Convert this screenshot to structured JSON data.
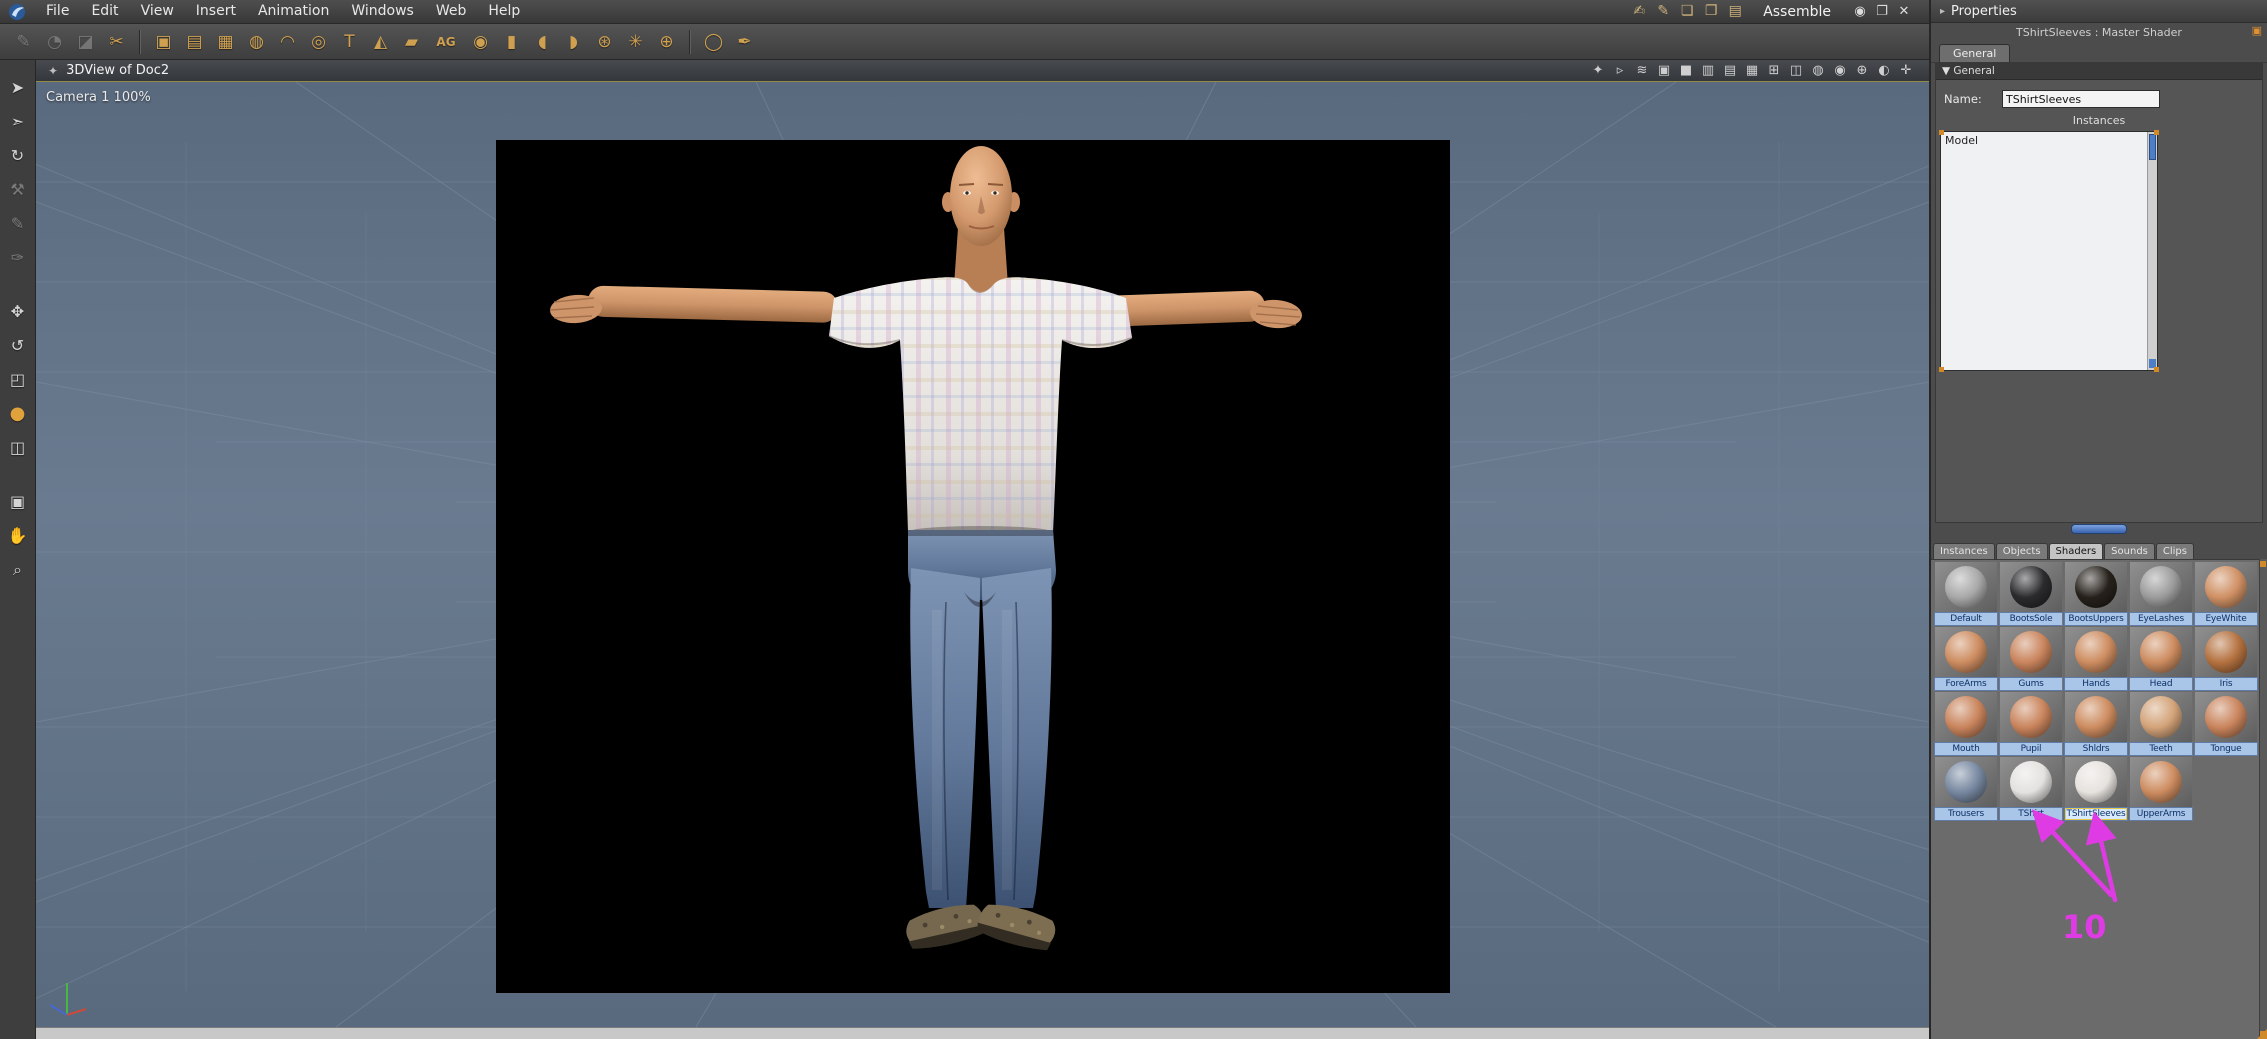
{
  "colors": {
    "annotation": "#df3be4",
    "label_bg": "#a9c6e8",
    "label_text": "#0e2f66",
    "viewport_bg": "#64748a",
    "grid_line": "#8593a6",
    "accent_blue": "#4e7ec6"
  },
  "menubar": {
    "items": [
      "File",
      "Edit",
      "View",
      "Insert",
      "Animation",
      "Windows",
      "Web",
      "Help"
    ],
    "room_icons": [
      {
        "glyph": "✍",
        "name": "room-icon-assemble"
      },
      {
        "glyph": "✎",
        "name": "room-icon-model"
      },
      {
        "glyph": "❏",
        "name": "room-icon-storyboard"
      },
      {
        "glyph": "❐",
        "name": "room-icon-texture"
      },
      {
        "glyph": "▤",
        "name": "room-icon-render"
      }
    ],
    "room_label": "Assemble",
    "window_controls": [
      {
        "glyph": "◉",
        "name": "visibility-button"
      },
      {
        "glyph": "❐",
        "name": "restore-button"
      },
      {
        "glyph": "✕",
        "name": "close-button"
      }
    ]
  },
  "toolbar": {
    "tools": [
      {
        "glyph": "✎",
        "name": "spline-pen-tool",
        "disabled": true
      },
      {
        "glyph": "◔",
        "name": "hand-draw-tool",
        "disabled": true
      },
      {
        "glyph": "◪",
        "name": "polyline-tool",
        "disabled": true
      },
      {
        "glyph": "✂",
        "name": "knife-tool"
      },
      {
        "sep": true
      },
      {
        "glyph": "▣",
        "name": "insert-cube"
      },
      {
        "glyph": "▤",
        "name": "insert-plane"
      },
      {
        "glyph": "▦",
        "name": "insert-grid"
      },
      {
        "glyph": "◍",
        "name": "insert-sphere"
      },
      {
        "glyph": "◠",
        "name": "insert-arc"
      },
      {
        "glyph": "◎",
        "name": "insert-torus"
      },
      {
        "glyph": "T",
        "name": "insert-text"
      },
      {
        "glyph": "◭",
        "name": "insert-cone"
      },
      {
        "glyph": "▰",
        "name": "insert-block"
      },
      {
        "glyph": "AG",
        "name": "insert-font",
        "wide": true
      },
      {
        "glyph": "◉",
        "name": "insert-target"
      },
      {
        "glyph": "▮",
        "name": "insert-cylinder"
      },
      {
        "glyph": "◖",
        "name": "insert-half-sphere"
      },
      {
        "glyph": "◗",
        "name": "insert-capsule"
      },
      {
        "glyph": "⊛",
        "name": "insert-particle-emitter"
      },
      {
        "glyph": "✳",
        "name": "insert-fountain"
      },
      {
        "glyph": "⊕",
        "name": "insert-atom"
      },
      {
        "sep": true
      },
      {
        "glyph": "◯",
        "name": "insert-light"
      },
      {
        "glyph": "✒",
        "name": "eyedropper-tool"
      }
    ]
  },
  "left_toolbar": {
    "tools": [
      {
        "glyph": "➤",
        "name": "select-tool"
      },
      {
        "glyph": "➣",
        "name": "direct-select-tool"
      },
      {
        "glyph": "↻",
        "name": "orbit-tool"
      },
      {
        "glyph": "⚒",
        "name": "wrench-tool",
        "disabled": true
      },
      {
        "glyph": "✎",
        "name": "pen-tool",
        "disabled": true
      },
      {
        "glyph": "✑",
        "name": "brush-tool",
        "disabled": true
      },
      {
        "gap": true
      },
      {
        "glyph": "✥",
        "name": "move-tool"
      },
      {
        "glyph": "↺",
        "name": "rotate-tool"
      },
      {
        "glyph": "◰",
        "name": "scale-tool"
      },
      {
        "glyph": "●",
        "name": "hot-point-tool",
        "gold": true
      },
      {
        "glyph": "◫",
        "name": "snap-tool"
      },
      {
        "gap": true
      },
      {
        "glyph": "▣",
        "name": "preview-quality-tool"
      },
      {
        "glyph": "✋",
        "name": "pan-tool"
      },
      {
        "glyph": "⌕",
        "name": "zoom-tool"
      }
    ]
  },
  "viewport": {
    "title": "3DView of Doc2",
    "title_icon": "✦",
    "camera_label": "Camera 1 100%",
    "titlebar_icons": [
      "✦",
      "▹",
      "≋",
      "▣",
      "■",
      "▥",
      "▤",
      "▦",
      "⊞",
      "◫",
      "◍",
      "◉",
      "⊕",
      "◐",
      "✛"
    ]
  },
  "properties": {
    "panel_title": "Properties",
    "panel_tri": "▸",
    "header": "TShirtSleeves : Master Shader",
    "menu_glyph": "▣",
    "tab_label": "General",
    "section_tri": "▼",
    "section_label": "General",
    "name_label": "Name:",
    "name_value": "TShirtSleeves",
    "instances_caption": "Instances",
    "instance_items": [
      "Model"
    ]
  },
  "browser": {
    "tabs": [
      "Instances",
      "Objects",
      "Shaders",
      "Sounds",
      "Clips"
    ],
    "active_tab": "Shaders",
    "shaders": [
      {
        "label": "Default",
        "color": "#a8a8a8"
      },
      {
        "label": "BootsSole",
        "color": "#2b2b2e"
      },
      {
        "label": "BootsUppers",
        "color": "#26211b"
      },
      {
        "label": "EyeLashes",
        "color": "#9b9b9b"
      },
      {
        "label": "EyeWhite",
        "color": "#cf9064"
      },
      {
        "label": "ForeArms",
        "color": "#cd8c60"
      },
      {
        "label": "Gums",
        "color": "#c9845c"
      },
      {
        "label": "Hands",
        "color": "#cd8c60"
      },
      {
        "label": "Head",
        "color": "#cd8c60"
      },
      {
        "label": "Iris",
        "color": "#b4713f"
      },
      {
        "label": "Mouth",
        "color": "#c9845c"
      },
      {
        "label": "Pupil",
        "color": "#c9845c"
      },
      {
        "label": "Shldrs",
        "color": "#cd8c60"
      },
      {
        "label": "Teeth",
        "color": "#d3a379"
      },
      {
        "label": "Tongue",
        "color": "#c9845c"
      },
      {
        "label": "Trousers",
        "color": "#76879f"
      },
      {
        "label": "TShirt",
        "color": "#e4e2df"
      },
      {
        "label": "TShirtSleeves",
        "color": "#e6e2de",
        "selected": true
      },
      {
        "label": "UpperArms",
        "color": "#cd8c60"
      }
    ]
  },
  "annotation": {
    "number": "10"
  }
}
